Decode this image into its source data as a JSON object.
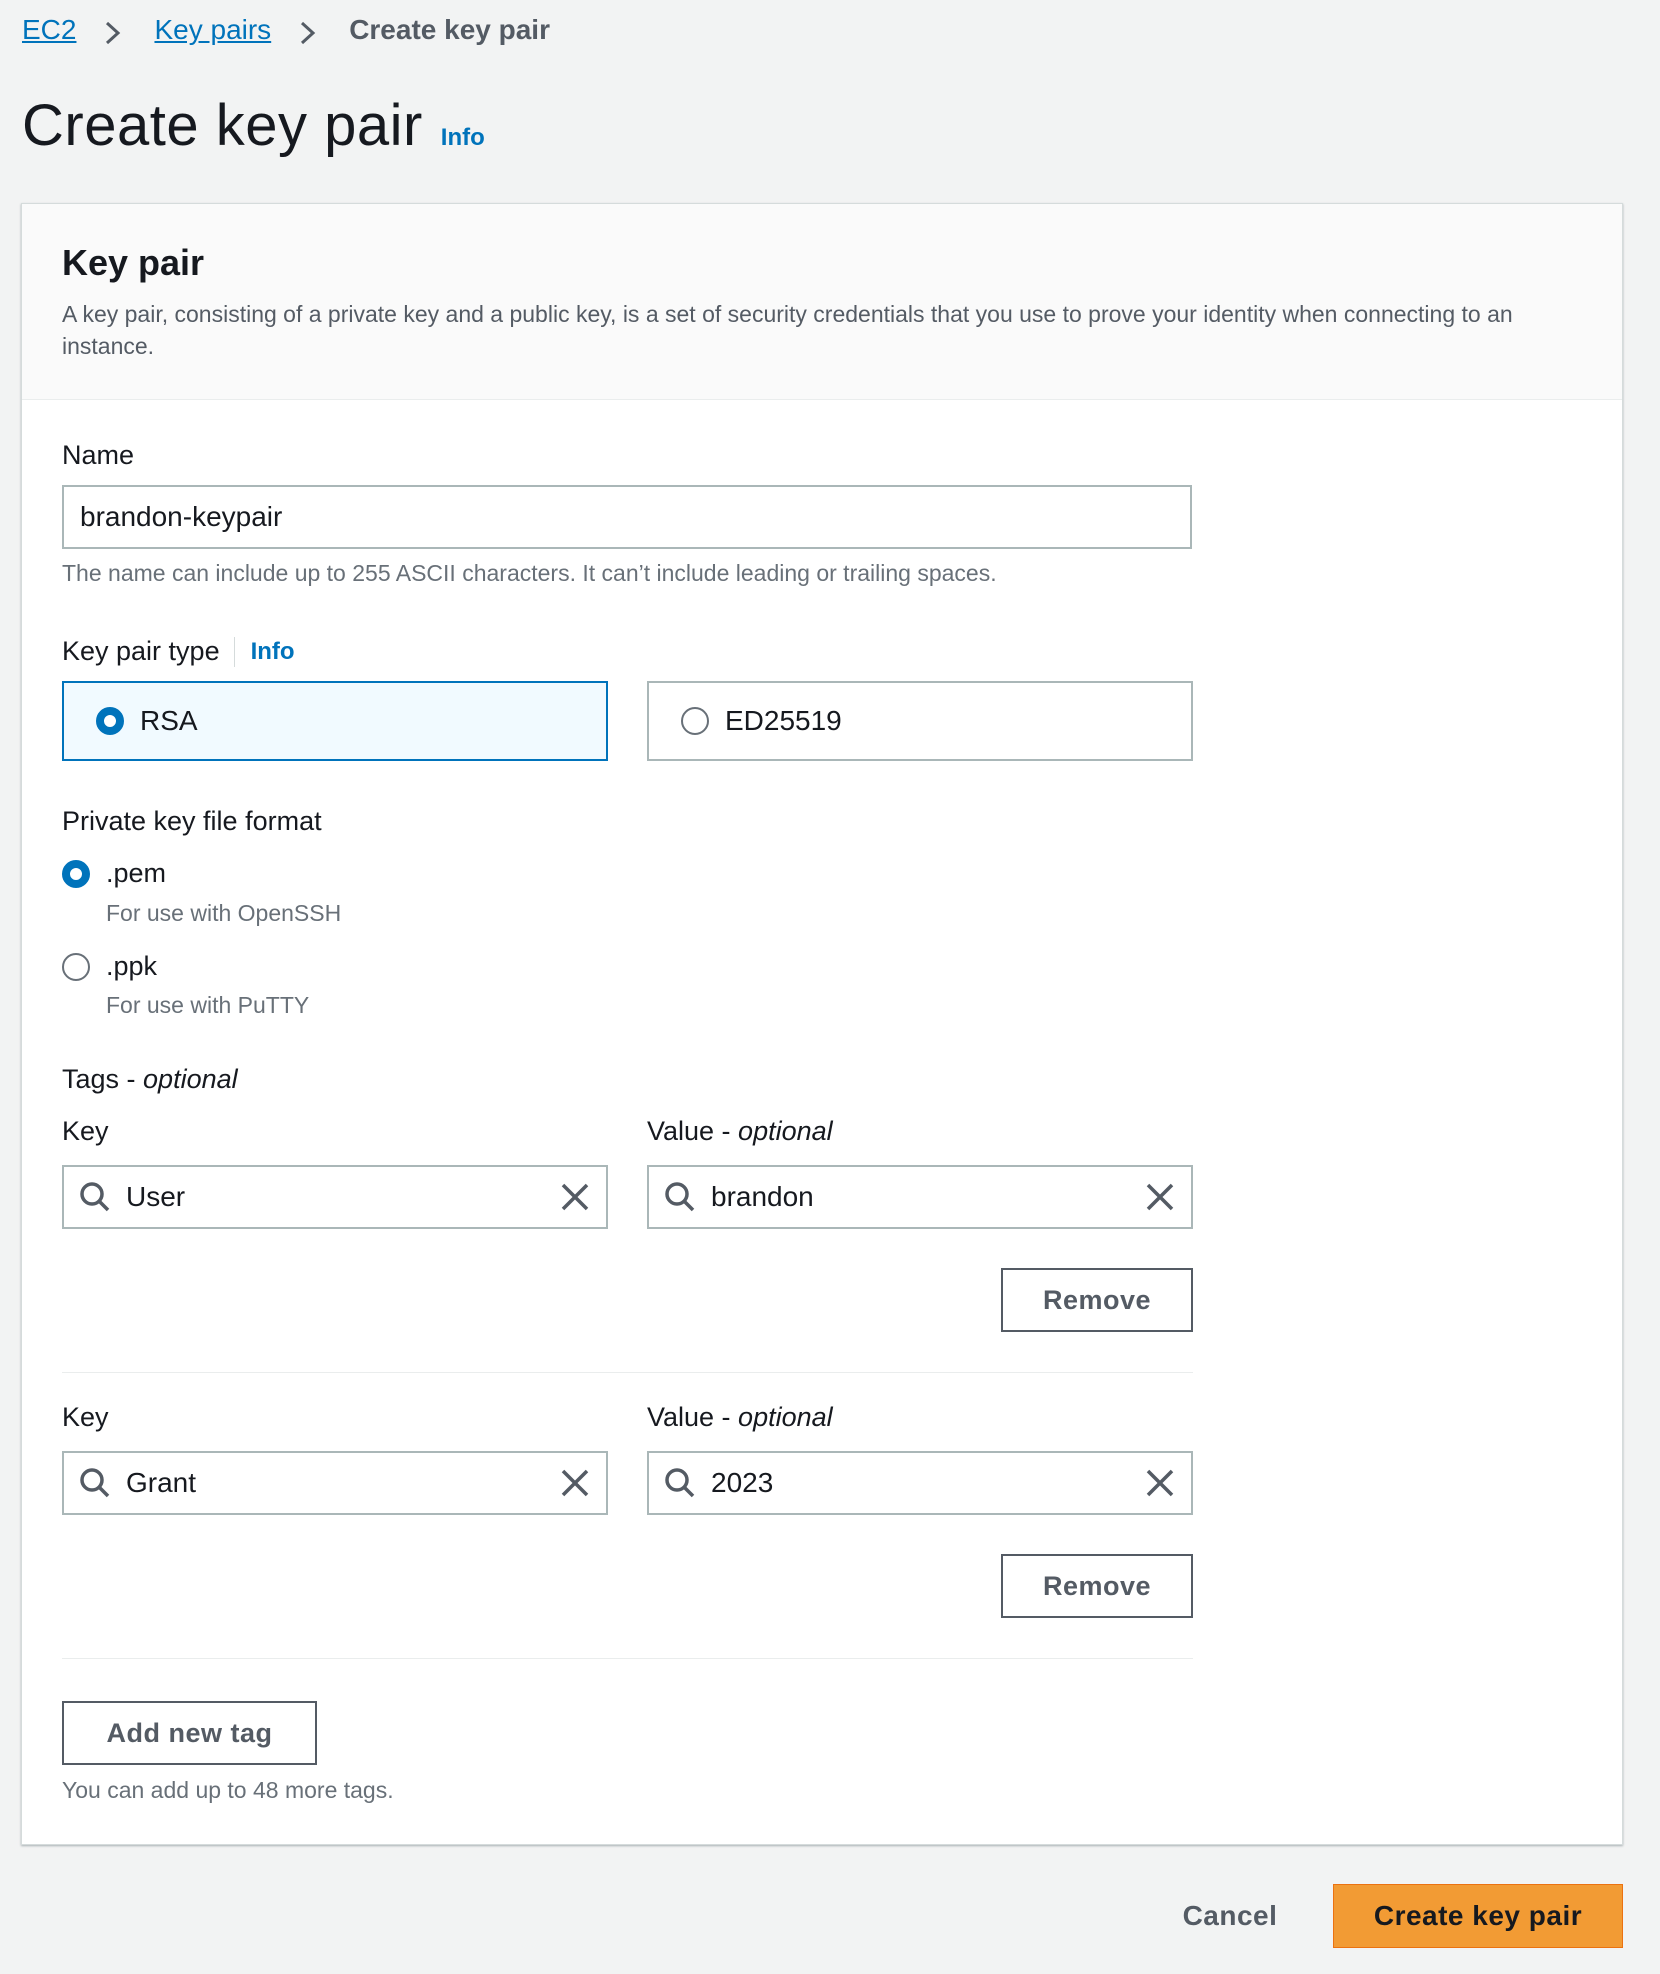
{
  "breadcrumb": {
    "items": [
      {
        "label": "EC2"
      },
      {
        "label": "Key pairs"
      }
    ],
    "current": "Create key pair"
  },
  "page": {
    "title": "Create key pair",
    "info": "Info"
  },
  "panel": {
    "title": "Key pair",
    "description": "A key pair, consisting of a private key and a public key, is a set of security credentials that you use to prove your identity when connecting to an instance."
  },
  "name_field": {
    "label": "Name",
    "value": "brandon-keypair",
    "hint": "The name can include up to 255 ASCII characters. It can’t include leading or trailing spaces."
  },
  "key_type": {
    "label": "Key pair type",
    "info": "Info",
    "options": [
      {
        "label": "RSA",
        "selected": true
      },
      {
        "label": "ED25519",
        "selected": false
      }
    ]
  },
  "file_format": {
    "label": "Private key file format",
    "options": [
      {
        "label": ".pem",
        "description": "For use with OpenSSH",
        "selected": true
      },
      {
        "label": ".ppk",
        "description": "For use with PuTTY",
        "selected": false
      }
    ]
  },
  "tags": {
    "label": "Tags - ",
    "label_optional": "optional",
    "key_label": "Key",
    "value_label": "Value - ",
    "value_optional": "optional",
    "remove_label": "Remove",
    "rows": [
      {
        "key": "User",
        "value": "brandon"
      },
      {
        "key": "Grant",
        "value": "2023"
      }
    ],
    "add_label": "Add new tag",
    "limit_hint": "You can add up to 48 more tags."
  },
  "footer": {
    "cancel_label": "Cancel",
    "create_label": "Create key pair"
  },
  "colors": {
    "accent": "#0073bb",
    "primary_button": "#f29b34",
    "background": "#f2f3f3"
  },
  "icons": {
    "breadcrumb_separator": "chevron-right-icon",
    "tag_search": "search-icon",
    "tag_clear": "close-icon"
  }
}
